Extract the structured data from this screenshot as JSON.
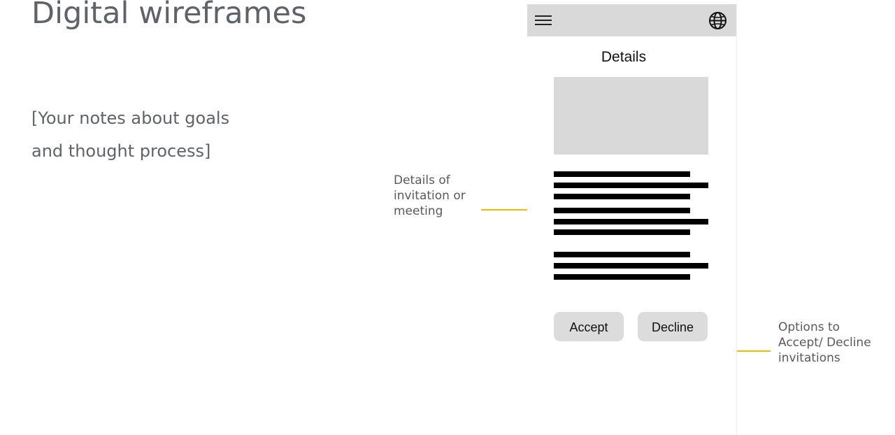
{
  "slide": {
    "title": "Digital wireframes",
    "notes_line1": "[Your notes about goals",
    "notes_line2": "and thought process]"
  },
  "annotations": {
    "details": {
      "line1": "Details of",
      "line2": "invitation or",
      "line3": "meeting"
    },
    "options": {
      "line1": "Options to",
      "line2": "Accept/ Decline",
      "line3": "invitations"
    },
    "arrow_color": "#f5b800"
  },
  "wireframe": {
    "topbar": {
      "left_icon": "menu-icon",
      "right_icon": "globe-icon"
    },
    "title": "Details",
    "buttons": {
      "accept": "Accept",
      "decline": "Decline"
    },
    "placeholder_color": "#d9d9d9"
  }
}
